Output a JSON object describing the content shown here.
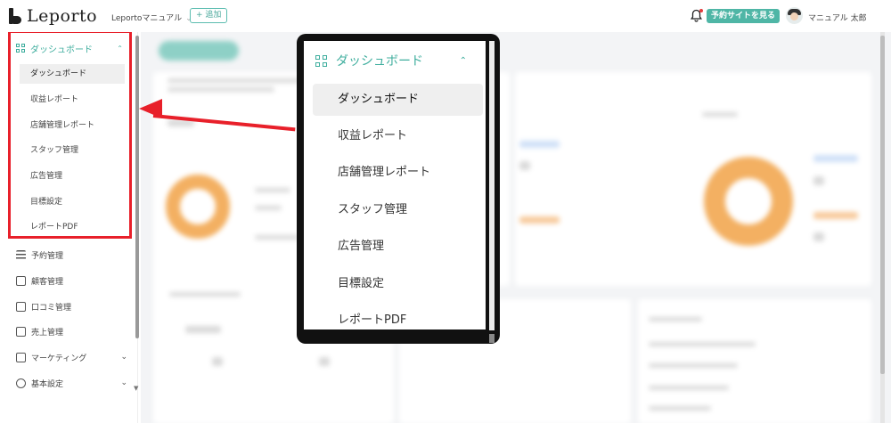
{
  "header": {
    "logo_text": "Leporto",
    "store_name": "Leportoマニュアル",
    "store_chevron": "⌄",
    "add_label": "+ 追加",
    "view_site_label": "予約サイトを見る",
    "user_name": "マニュアル 太郎"
  },
  "sidebar": {
    "dashboard_group": {
      "label": "ダッシュボード",
      "caret": "⌃",
      "items": [
        {
          "label": "ダッシュボード",
          "active": true
        },
        {
          "label": "収益レポート"
        },
        {
          "label": "店舗管理レポート"
        },
        {
          "label": "スタッフ管理"
        },
        {
          "label": "広告管理"
        },
        {
          "label": "目標設定"
        },
        {
          "label": "レポートPDF"
        }
      ]
    },
    "items": [
      {
        "label": "予約管理",
        "icon": "list-icon"
      },
      {
        "label": "顧客管理",
        "icon": "customer-icon"
      },
      {
        "label": "口コミ管理",
        "icon": "review-icon"
      },
      {
        "label": "売上管理",
        "icon": "sales-icon"
      },
      {
        "label": "マーケティング",
        "icon": "marketing-icon",
        "caret": "⌄"
      },
      {
        "label": "基本設定",
        "icon": "gear-icon",
        "caret": "⌄"
      }
    ]
  },
  "zoom": {
    "header_label": "ダッシュボード",
    "caret": "⌃",
    "items": [
      {
        "label": "ダッシュボード",
        "active": true
      },
      {
        "label": "収益レポート"
      },
      {
        "label": "店舗管理レポート"
      },
      {
        "label": "スタッフ管理"
      },
      {
        "label": "広告管理"
      },
      {
        "label": "目標設定"
      },
      {
        "label": "レポートPDF"
      }
    ]
  },
  "colors": {
    "accent": "#3fae9e",
    "highlight": "#e8202a",
    "donut": "#f3b062"
  }
}
